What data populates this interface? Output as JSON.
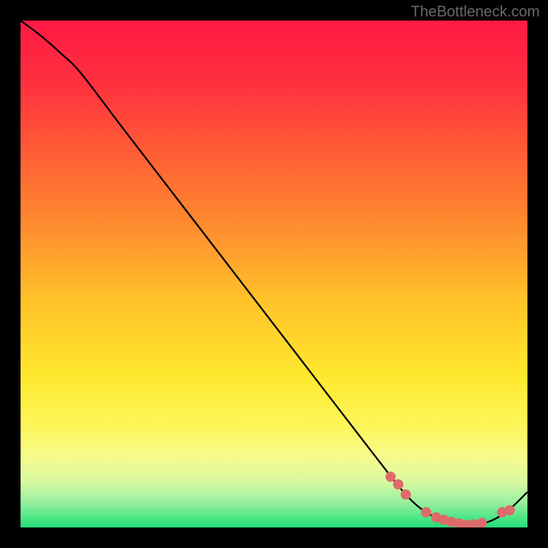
{
  "watermark": "TheBottleneck.com",
  "chart_data": {
    "type": "line",
    "title": "",
    "xlabel": "",
    "ylabel": "",
    "xlim": [
      0,
      100
    ],
    "ylim": [
      0,
      100
    ],
    "series": [
      {
        "name": "curve",
        "x": [
          0,
          4,
          8,
          12,
          20,
          30,
          40,
          50,
          60,
          70,
          76,
          80,
          84,
          88,
          92,
          96,
          100
        ],
        "values": [
          100,
          97,
          93.5,
          89.5,
          79,
          66,
          53,
          40,
          27,
          14,
          6.5,
          3,
          1.2,
          0.5,
          1,
          3.2,
          7
        ]
      }
    ],
    "markers": {
      "name": "highlighted-points",
      "color": "#dd6b6b",
      "x": [
        73,
        74.5,
        76,
        80,
        82,
        83.5,
        85,
        86.5,
        88,
        89.5,
        91,
        95,
        96.5
      ],
      "values": [
        10,
        8.5,
        6.5,
        3,
        2,
        1.5,
        1.1,
        0.8,
        0.5,
        0.6,
        0.9,
        3,
        3.4
      ]
    },
    "background_gradient": {
      "stops": [
        {
          "offset": 0.0,
          "color": "#ff1a44"
        },
        {
          "offset": 0.12,
          "color": "#ff2f3f"
        },
        {
          "offset": 0.25,
          "color": "#ff5a36"
        },
        {
          "offset": 0.4,
          "color": "#ff8a2f"
        },
        {
          "offset": 0.55,
          "color": "#ffc229"
        },
        {
          "offset": 0.7,
          "color": "#ffe82e"
        },
        {
          "offset": 0.8,
          "color": "#fdf65a"
        },
        {
          "offset": 0.86,
          "color": "#f6fb8c"
        },
        {
          "offset": 0.91,
          "color": "#d8f9a0"
        },
        {
          "offset": 0.95,
          "color": "#9af0a0"
        },
        {
          "offset": 0.98,
          "color": "#4fe687"
        },
        {
          "offset": 1.0,
          "color": "#22dd77"
        }
      ]
    }
  }
}
